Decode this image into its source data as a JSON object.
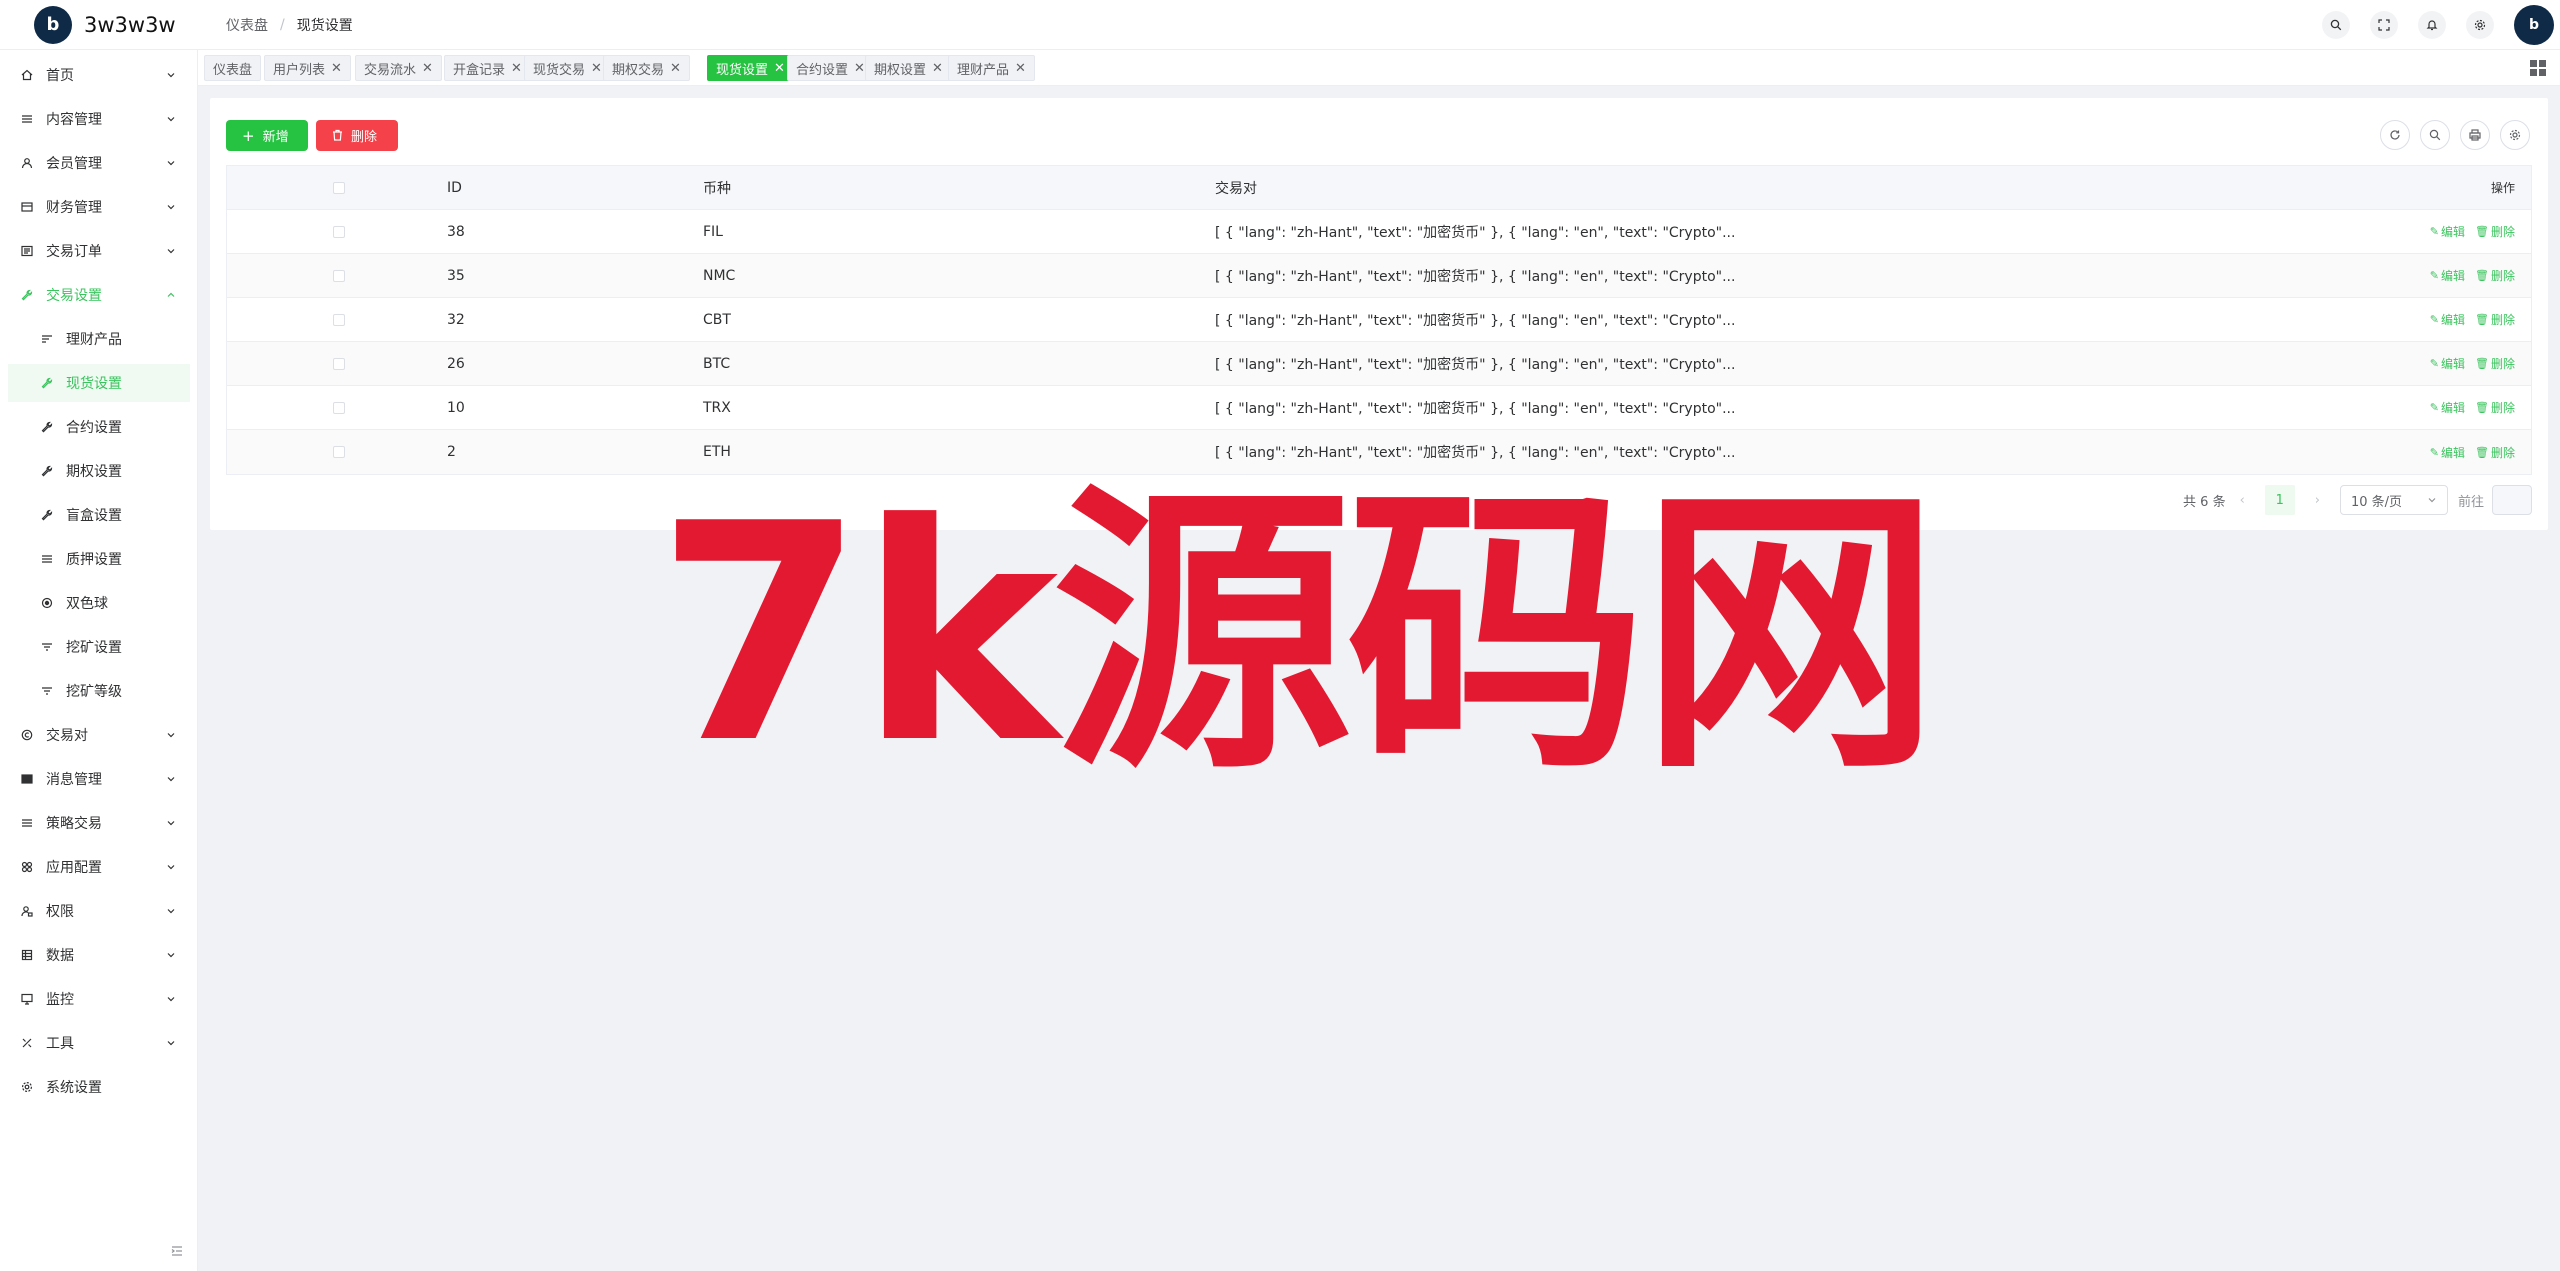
{
  "app": {
    "name": "3w3w3w",
    "logo_text": "b"
  },
  "breadcrumb": [
    "仪表盘",
    "现货设置"
  ],
  "header_icons": [
    "search-icon",
    "fullscreen-icon",
    "bell-icon",
    "gear-icon"
  ],
  "sidebar": {
    "items": [
      {
        "label": "首页",
        "icon": "home-icon",
        "chevron": true
      },
      {
        "label": "内容管理",
        "icon": "list-icon",
        "chevron": true
      },
      {
        "label": "会员管理",
        "icon": "user-icon",
        "chevron": true
      },
      {
        "label": "财务管理",
        "icon": "wallet-icon",
        "chevron": true
      },
      {
        "label": "交易订单",
        "icon": "order-icon",
        "chevron": true
      },
      {
        "label": "交易设置",
        "icon": "wrench-icon",
        "chevron": true,
        "expanded": true
      },
      {
        "label": "理财产品",
        "icon": "sort-icon",
        "sub": true
      },
      {
        "label": "现货设置",
        "icon": "wrench-icon",
        "sub": true,
        "active": true
      },
      {
        "label": "合约设置",
        "icon": "wrench-icon",
        "sub": true
      },
      {
        "label": "期权设置",
        "icon": "wrench-icon",
        "sub": true
      },
      {
        "label": "盲盒设置",
        "icon": "wrench-icon",
        "sub": true
      },
      {
        "label": "质押设置",
        "icon": "list-icon",
        "sub": true
      },
      {
        "label": "双色球",
        "icon": "target-icon",
        "sub": true
      },
      {
        "label": "挖矿设置",
        "icon": "filter-icon",
        "sub": true
      },
      {
        "label": "挖矿等级",
        "icon": "filter-icon",
        "sub": true
      },
      {
        "label": "交易对",
        "icon": "copyright-icon",
        "chevron": true
      },
      {
        "label": "消息管理",
        "icon": "message-icon",
        "chevron": true
      },
      {
        "label": "策略交易",
        "icon": "list-icon",
        "chevron": true
      },
      {
        "label": "应用配置",
        "icon": "apps-icon",
        "chevron": true
      },
      {
        "label": "权限",
        "icon": "user-lock-icon",
        "chevron": true
      },
      {
        "label": "数据",
        "icon": "database-icon",
        "chevron": true
      },
      {
        "label": "监控",
        "icon": "monitor-icon",
        "chevron": true
      },
      {
        "label": "工具",
        "icon": "tools-icon",
        "chevron": true
      },
      {
        "label": "系统设置",
        "icon": "gear-icon",
        "chevron": false
      }
    ]
  },
  "tabs": [
    {
      "label": "仪表盘",
      "closable": false
    },
    {
      "label": "用户列表",
      "closable": true
    },
    {
      "label": "交易流水",
      "closable": true
    },
    {
      "label": "开盒记录",
      "closable": true
    },
    {
      "label": "现货交易",
      "closable": true
    },
    {
      "label": "期权交易",
      "closable": true
    },
    {
      "label": "现货设置",
      "closable": true,
      "active": true
    },
    {
      "label": "合约设置",
      "closable": true
    },
    {
      "label": "期权设置",
      "closable": true
    },
    {
      "label": "理财产品",
      "closable": true
    }
  ],
  "toolbar": {
    "add_label": "新增",
    "delete_label": "删除"
  },
  "table": {
    "headers": {
      "id": "ID",
      "coin": "币种",
      "pair": "交易对",
      "ops": "操作"
    },
    "edit_label": "编辑",
    "delete_label": "删除",
    "rows": [
      {
        "id": "38",
        "coin": "FIL",
        "pair": "[ { \"lang\": \"zh-Hant\", \"text\": \"加密货币\" }, { \"lang\": \"en\", \"text\": \"Crypto\"..."
      },
      {
        "id": "35",
        "coin": "NMC",
        "pair": "[ { \"lang\": \"zh-Hant\", \"text\": \"加密货币\" }, { \"lang\": \"en\", \"text\": \"Crypto\"..."
      },
      {
        "id": "32",
        "coin": "CBT",
        "pair": "[ { \"lang\": \"zh-Hant\", \"text\": \"加密货币\" }, { \"lang\": \"en\", \"text\": \"Crypto\"..."
      },
      {
        "id": "26",
        "coin": "BTC",
        "pair": "[ { \"lang\": \"zh-Hant\", \"text\": \"加密货币\" }, { \"lang\": \"en\", \"text\": \"Crypto\"..."
      },
      {
        "id": "10",
        "coin": "TRX",
        "pair": "[ { \"lang\": \"zh-Hant\", \"text\": \"加密货币\" }, { \"lang\": \"en\", \"text\": \"Crypto\"..."
      },
      {
        "id": "2",
        "coin": "ETH",
        "pair": "[ { \"lang\": \"zh-Hant\", \"text\": \"加密货币\" }, { \"lang\": \"en\", \"text\": \"Crypto\"..."
      }
    ]
  },
  "pagination": {
    "total_text": "共 6 条",
    "current_page": "1",
    "page_size": "10 条/页",
    "goto_label": "前往"
  },
  "watermark": {
    "text": "7k源码网"
  },
  "colors": {
    "accent": "#26c241",
    "danger": "#f5424a",
    "watermark": "#e3122b",
    "logo_bg": "#0e2a47"
  }
}
